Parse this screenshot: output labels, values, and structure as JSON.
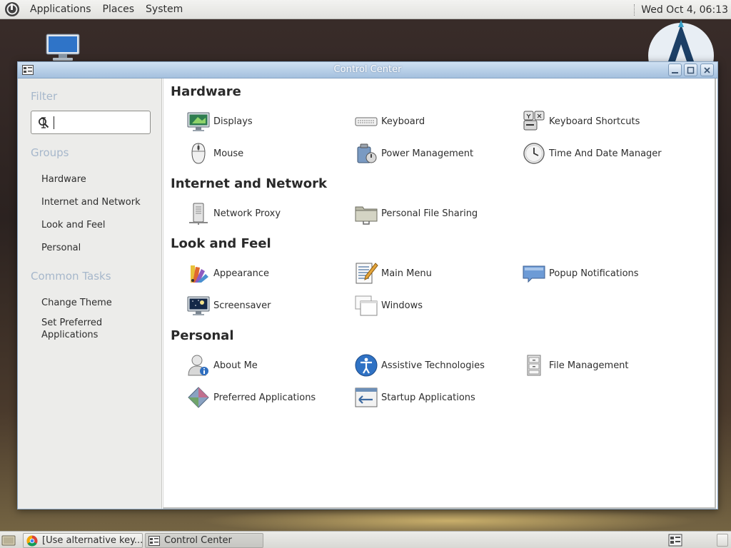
{
  "top_panel": {
    "menus": [
      "Applications",
      "Places",
      "System"
    ],
    "clock": "Wed Oct  4, 06:13"
  },
  "window": {
    "title": "Control Center"
  },
  "sidebar": {
    "filter_heading": "Filter",
    "search_value": "",
    "groups_heading": "Groups",
    "groups": [
      "Hardware",
      "Internet and Network",
      "Look and Feel",
      "Personal"
    ],
    "tasks_heading": "Common Tasks",
    "tasks": [
      "Change Theme",
      "Set Preferred Applications"
    ]
  },
  "sections": [
    {
      "title": "Hardware",
      "items": [
        {
          "label": "Displays",
          "icon": "display-icon"
        },
        {
          "label": "Keyboard",
          "icon": "keyboard-icon"
        },
        {
          "label": "Keyboard Shortcuts",
          "icon": "keyboard-shortcuts-icon"
        },
        {
          "label": "Mouse",
          "icon": "mouse-icon"
        },
        {
          "label": "Power Management",
          "icon": "power-management-icon"
        },
        {
          "label": "Time And Date Manager",
          "icon": "clock-icon"
        }
      ]
    },
    {
      "title": "Internet and Network",
      "items": [
        {
          "label": "Network Proxy",
          "icon": "network-proxy-icon"
        },
        {
          "label": "Personal File Sharing",
          "icon": "shared-folder-icon"
        }
      ]
    },
    {
      "title": "Look and Feel",
      "items": [
        {
          "label": "Appearance",
          "icon": "appearance-icon"
        },
        {
          "label": "Main Menu",
          "icon": "main-menu-icon"
        },
        {
          "label": "Popup Notifications",
          "icon": "popup-notification-icon"
        },
        {
          "label": "Screensaver",
          "icon": "screensaver-icon"
        },
        {
          "label": "Windows",
          "icon": "windows-icon"
        }
      ]
    },
    {
      "title": "Personal",
      "items": [
        {
          "label": "About Me",
          "icon": "about-me-icon"
        },
        {
          "label": "Assistive Technologies",
          "icon": "accessibility-icon"
        },
        {
          "label": "File Management",
          "icon": "file-cabinet-icon"
        },
        {
          "label": "Preferred Applications",
          "icon": "preferred-apps-icon"
        },
        {
          "label": "Startup Applications",
          "icon": "startup-apps-icon"
        }
      ]
    }
  ],
  "taskbar": {
    "tasks": [
      "[Use alternative key...",
      "Control Center"
    ]
  }
}
